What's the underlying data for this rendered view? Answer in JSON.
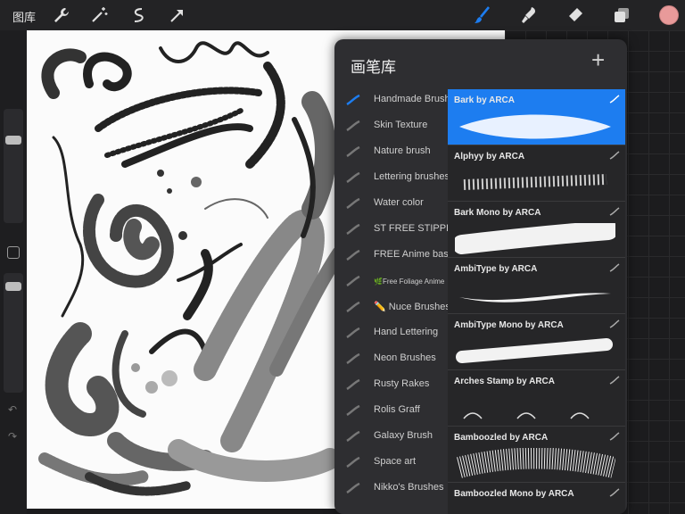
{
  "topbar": {
    "gallery_label": "图库",
    "tools": [
      "wrench-icon",
      "magic-wand-icon",
      "selection-icon",
      "transform-icon"
    ],
    "right_tools": [
      "brush-icon",
      "smudge-icon",
      "eraser-icon",
      "layers-icon"
    ],
    "active_tool": "brush-icon",
    "accent_color": "#1d7df0",
    "current_color": "#e89a9a"
  },
  "panel": {
    "title": "画笔库",
    "add_label": "+",
    "categories": [
      {
        "label": "Handmade Brush"
      },
      {
        "label": "Skin Texture"
      },
      {
        "label": "Nature brush"
      },
      {
        "label": "Lettering brushes"
      },
      {
        "label": "Water color"
      },
      {
        "label": "ST FREE STIPPLE"
      },
      {
        "label": "FREE Anime basic"
      },
      {
        "label": "🌿Free Foliage Anime"
      },
      {
        "label": "✏️ Nuce Brushes"
      },
      {
        "label": "Hand Lettering"
      },
      {
        "label": "Neon Brushes"
      },
      {
        "label": "Rusty Rakes"
      },
      {
        "label": "Rolis Graff"
      },
      {
        "label": "Galaxy Brush"
      },
      {
        "label": "Space art"
      },
      {
        "label": "Nikko's Brushes"
      }
    ],
    "brushes": [
      {
        "name": "Bark by ARCA",
        "selected": true
      },
      {
        "name": "Alphyy by ARCA",
        "selected": false
      },
      {
        "name": "Bark Mono by ARCA",
        "selected": false
      },
      {
        "name": "AmbiType by ARCA",
        "selected": false
      },
      {
        "name": "AmbiType Mono by ARCA",
        "selected": false
      },
      {
        "name": "Arches Stamp by ARCA",
        "selected": false
      },
      {
        "name": "Bamboozled by ARCA",
        "selected": false
      },
      {
        "name": "Bamboozled Mono by ARCA",
        "selected": false
      }
    ]
  }
}
